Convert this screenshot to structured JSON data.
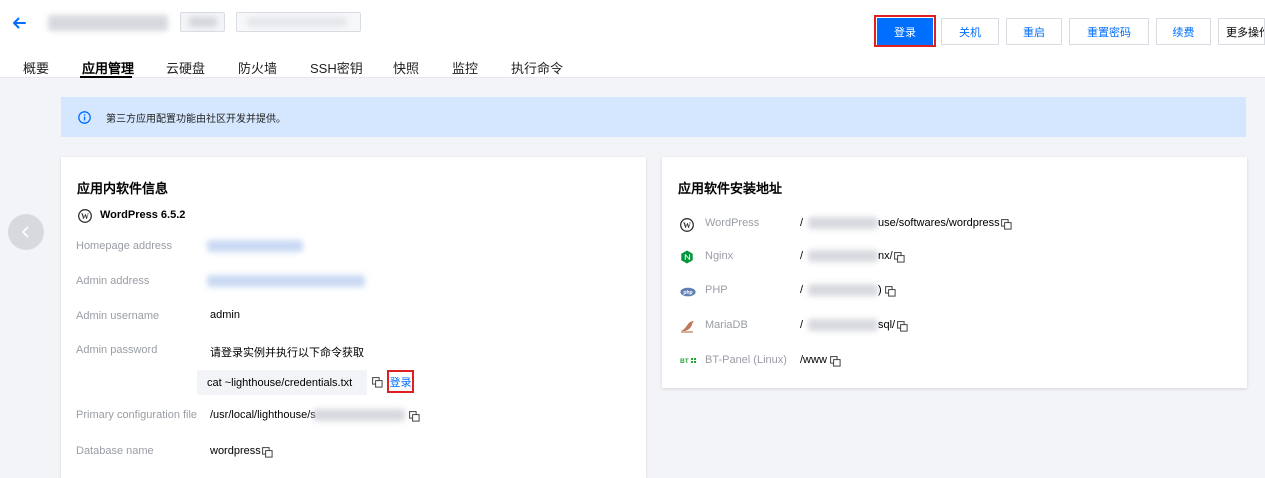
{
  "header": {
    "buttons": {
      "login": "登录",
      "shutdown": "关机",
      "restart": "重启",
      "reset_password": "重置密码",
      "renew": "续费",
      "more": "更多操作"
    }
  },
  "tabs": [
    "概要",
    "应用管理",
    "云硬盘",
    "防火墙",
    "SSH密钥",
    "快照",
    "监控",
    "执行命令"
  ],
  "notice": "第三方应用配置功能由社区开发并提供。",
  "software_info": {
    "title": "应用内软件信息",
    "app_name": "WordPress 6.5.2",
    "rows": [
      {
        "label": "Homepage address",
        "value": ""
      },
      {
        "label": "Admin address",
        "value": ""
      },
      {
        "label": "Admin username",
        "value": "admin"
      },
      {
        "label": "Admin password",
        "value": "请登录实例并执行以下命令获取"
      },
      {
        "label": "Primary configuration file",
        "value": "/usr/local/lighthouse/s"
      },
      {
        "label": "Database name",
        "value": "wordpress"
      }
    ],
    "command": "cat ~lighthouse/credentials.txt",
    "command_login": "登录"
  },
  "install_paths": {
    "title": "应用软件安装地址",
    "items": [
      {
        "name": "WordPress",
        "icon": "wordpress-icon",
        "prefix": "/",
        "suffix": "use/softwares/wordpress"
      },
      {
        "name": "Nginx",
        "icon": "nginx-icon",
        "prefix": "/",
        "suffix": "nx/"
      },
      {
        "name": "PHP",
        "icon": "php-icon",
        "prefix": "/",
        "suffix": ")"
      },
      {
        "name": "MariaDB",
        "icon": "mariadb-icon",
        "prefix": "/",
        "suffix": "sql/"
      },
      {
        "name": "BT-Panel (Linux)",
        "icon": "bt-panel-icon",
        "prefix": "/www",
        "suffix": ""
      }
    ]
  },
  "colors": {
    "accent": "#006eff",
    "highlight": "#e02020",
    "notice_bg": "#d5e7fe"
  }
}
